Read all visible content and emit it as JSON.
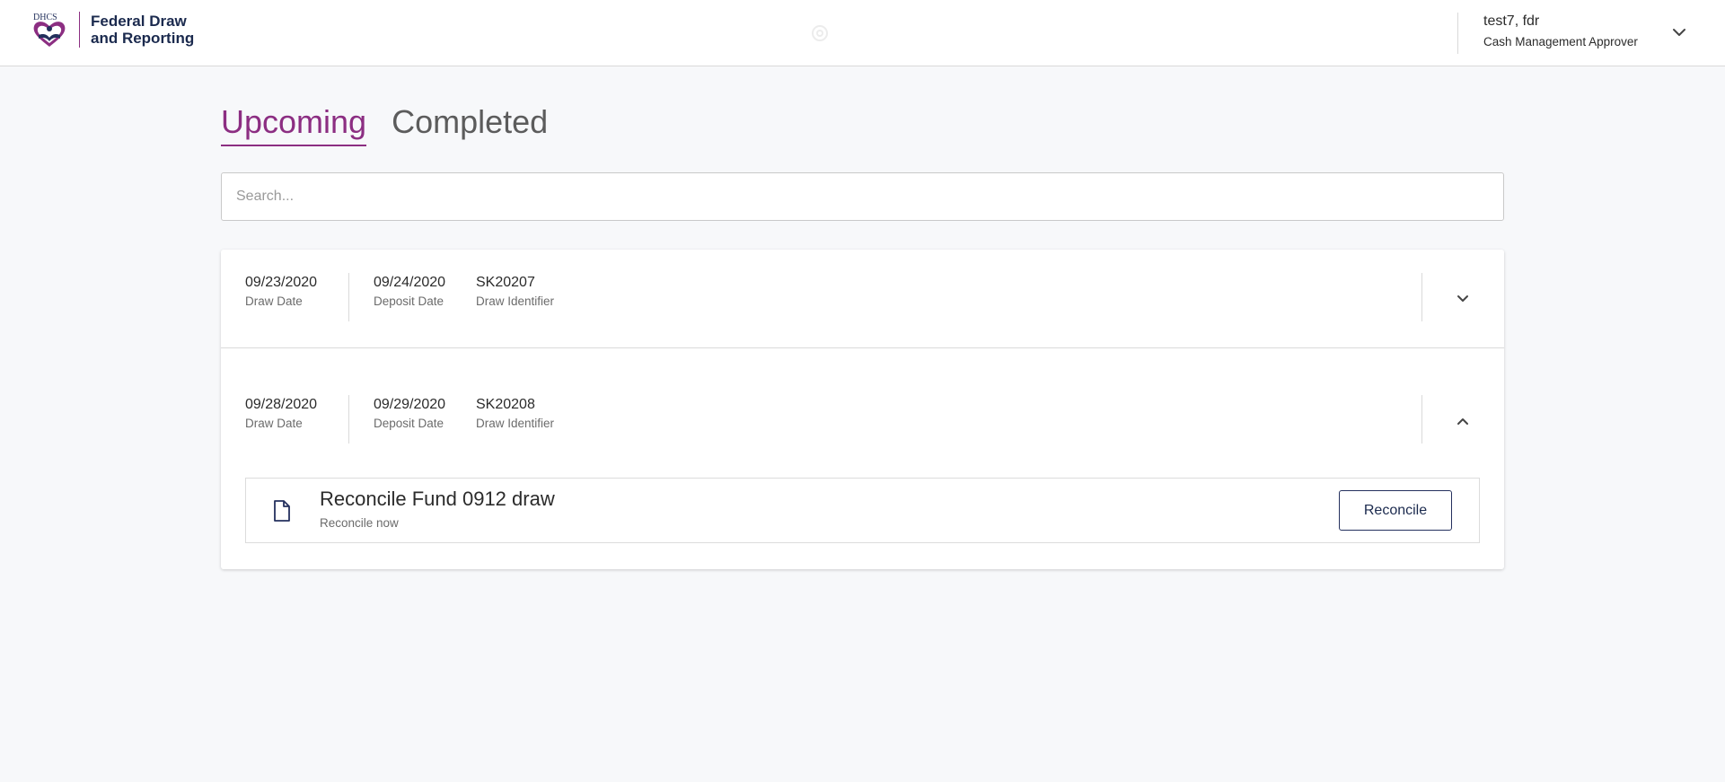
{
  "header": {
    "logo_text": "DHCS",
    "app_name_line1": "Federal Draw",
    "app_name_line2": "and Reporting",
    "user": {
      "name": "test7, fdr",
      "role": "Cash Management Approver"
    }
  },
  "tabs": [
    {
      "label": "Upcoming",
      "active": true
    },
    {
      "label": "Completed",
      "active": false
    }
  ],
  "search": {
    "placeholder": "Search...",
    "value": ""
  },
  "draws": [
    {
      "draw_date": "09/23/2020",
      "draw_date_label": "Draw Date",
      "deposit_date": "09/24/2020",
      "deposit_date_label": "Deposit Date",
      "draw_identifier": "SK20207",
      "draw_identifier_label": "Draw Identifier",
      "expanded": false
    },
    {
      "draw_date": "09/28/2020",
      "draw_date_label": "Draw Date",
      "deposit_date": "09/29/2020",
      "deposit_date_label": "Deposit Date",
      "draw_identifier": "SK20208",
      "draw_identifier_label": "Draw Identifier",
      "expanded": true,
      "task": {
        "title": "Reconcile Fund 0912 draw",
        "subtitle": "Reconcile now",
        "action_label": "Reconcile"
      }
    }
  ],
  "colors": {
    "accent": "#8c2e82",
    "navy": "#1b2a4e",
    "background": "#f7f8fa"
  },
  "icons": {
    "user_menu": "chevron-down-icon",
    "collapsed_row": "chevron-down-icon",
    "expanded_row": "chevron-up-icon",
    "task": "document-icon"
  }
}
